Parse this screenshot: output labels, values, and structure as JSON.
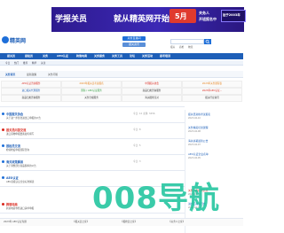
{
  "banner": {
    "headline": "学报关员",
    "subhead": "就从精英网开始",
    "promo_badge": "5月",
    "promo_line1": "关务人",
    "promo_line2": "开班报名中",
    "cta": "始于2003年"
  },
  "header": {
    "logo_text": "精英网",
    "btn_1": "关务直播间",
    "btn_2": "报关资讯",
    "search_placeholder": "",
    "links": [
      "报关",
      "商检",
      "物流"
    ]
  },
  "nav": {
    "items": [
      "报关员",
      "报检员",
      "关务",
      "AEO认证",
      "跨境电商",
      "关务服务",
      "关务工具",
      "论坛",
      "关务活动",
      "报考培训"
    ]
  },
  "subnav": {
    "items": [
      "今日",
      "热门",
      "推荐",
      "精华",
      "关注"
    ]
  },
  "tabs": {
    "items": [
      "关务资讯",
      "最新政策",
      "关务问答"
    ]
  },
  "adgrid": [
    [
      "AEO认证咨询服务",
      "2023年报关员考试报名",
      "中国报关协会",
      "2023年关务课程表"
    ],
    [
      "进口报关代理服务",
      "国际 / AEO认证服务",
      "商品归类咨询服务",
      "2023年AEO认证..."
    ],
    [
      "商品归类咨询服务",
      "关务合规服务",
      "海关稽查应对",
      "报关行业资讯"
    ]
  ],
  "sections": [
    {
      "title": "中国报关协会",
      "meta": "今日: 12  主题: 3456",
      "post": "关于进一步优化进出口申报的公告"
    },
    {
      "title": "报关员问答交流",
      "meta": "今日: 8",
      "post": "进口货物申报要素如何填写"
    },
    {
      "title": "报检员交流",
      "meta": "今日: 5",
      "post": "检验检疫申报流程咨询"
    },
    {
      "title": "海关政策解读",
      "meta": "今日: 3",
      "post": "关于调整部分商品税率的公告"
    },
    {
      "title": "AEO认证",
      "meta": "今日: 6",
      "post": "AEO高级认证企业标准解读"
    },
    {
      "title": "跨境电商",
      "meta": "今日: 2",
      "post": "跨境电商零售进口清单申报"
    }
  ],
  "right_col": [
    {
      "title": "报关员资格考试报名",
      "meta": "2023-04-10"
    },
    {
      "title": "关务精英培训课程",
      "meta": "2023-04-08"
    },
    {
      "title": "海关总署最新公告",
      "meta": "2023-04-07"
    },
    {
      "title": "AEO认证企业名单",
      "meta": "2023-04-05"
    },
    {
      "title": "关务人员招聘信息",
      "meta": "2023-04-03"
    },
    {
      "title": "进出口商品归类",
      "meta": "2023-04-01"
    }
  ],
  "watermark": "008导航",
  "footer": {
    "items": [
      "2023年 AEO认证专题",
      "【报关员之家】",
      "【报检员之家】",
      "【关务人之家】"
    ]
  },
  "colors": {
    "banner": "#3b28b5",
    "nav": "#1e5fb8",
    "accent": "#1e6fd9",
    "watermark": "#18c39b"
  }
}
